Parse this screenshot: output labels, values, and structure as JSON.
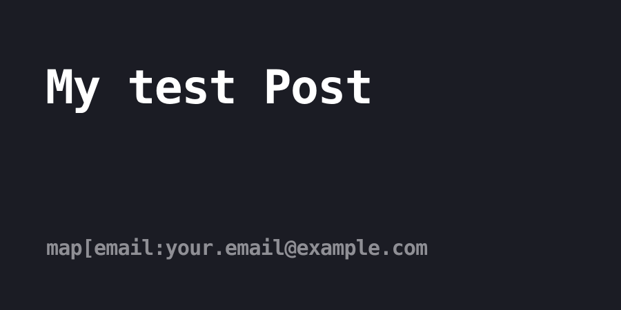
{
  "card": {
    "title": "My test Post",
    "author": "map[email:your.email@example.com",
    "colors": {
      "background": "#1b1c24",
      "title": "#ffffff",
      "author": "#8f8f95"
    }
  }
}
